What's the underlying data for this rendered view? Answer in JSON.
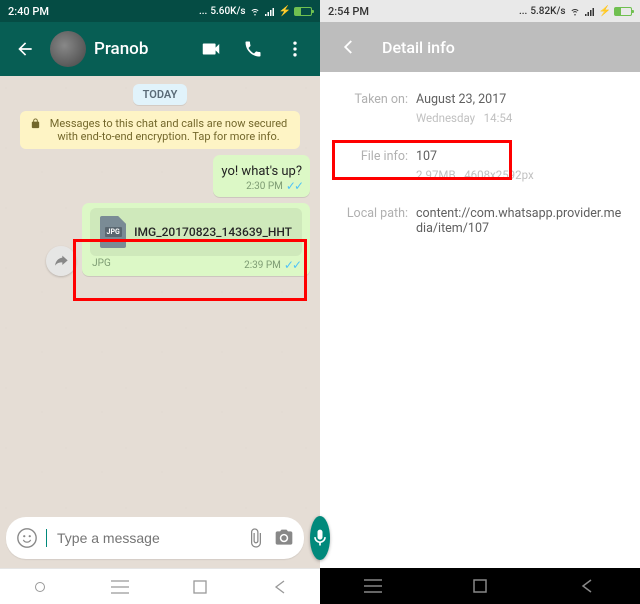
{
  "left": {
    "status_time": "2:40 PM",
    "status_speed": "5.60K/s",
    "header": {
      "name": "Pranob"
    },
    "date_chip": "TODAY",
    "encryption_notice": "Messages to this chat and calls are now secured with end-to-end encryption. Tap for more info.",
    "msg1": {
      "text": "yo! what's up?",
      "time": "2:30 PM"
    },
    "file_msg": {
      "filename": "IMG_20170823_143639_HHT",
      "ext": "JPG",
      "ext_badge": "JPG",
      "time": "2:39 PM"
    },
    "input_placeholder": "Type a message"
  },
  "right": {
    "status_time": "2:54 PM",
    "status_speed": "5.82K/s",
    "header_title": "Detail info",
    "taken_on": {
      "label": "Taken on:",
      "date": "August 23, 2017",
      "day": "Wednesday",
      "time": "14:54"
    },
    "file_info": {
      "label": "File info:",
      "name": "107",
      "size": "2.97MB",
      "dims": "4608x2592px"
    },
    "local_path": {
      "label": "Local path:",
      "value": "content://com.whatsapp.provider.media/item/107"
    }
  }
}
